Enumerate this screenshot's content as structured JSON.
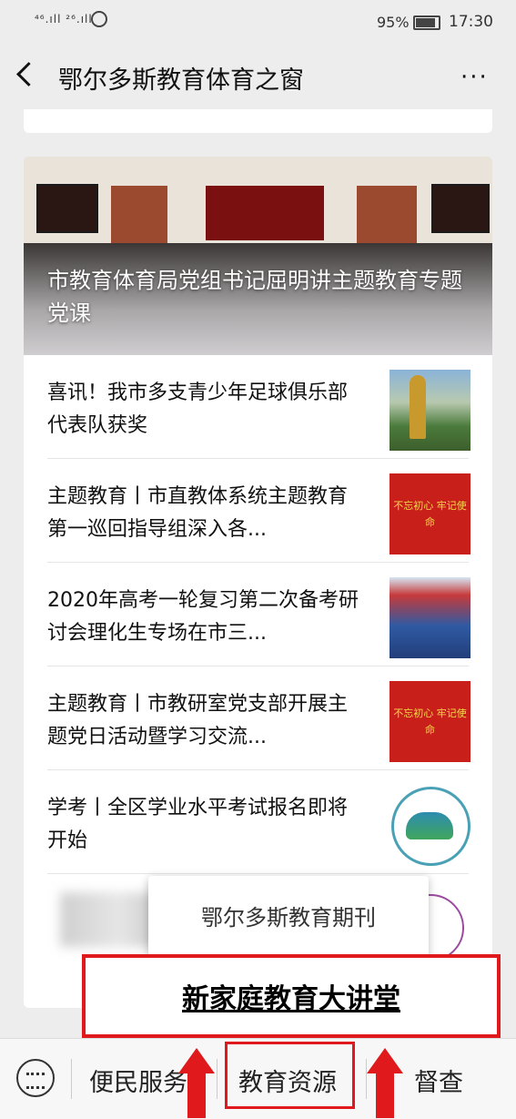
{
  "status": {
    "signal_text": "⁴⁶.ıll ²⁶.ıll",
    "battery": "95%",
    "time": "17:30"
  },
  "nav": {
    "title": "鄂尔多斯教育体育之窗",
    "more": "···"
  },
  "hero": {
    "caption": "市教育体育局党组书记屈明讲主题教育专题党课"
  },
  "articles": [
    {
      "title": "喜讯！我市多支青少年足球俱乐部代表队获奖"
    },
    {
      "title": "主题教育丨市直教体系统主题教育第一巡回指导组深入各...",
      "thumb_text": "不忘初心 牢记使命"
    },
    {
      "title": "2020年高考一轮复习第二次备考研讨会理化生专场在市三..."
    },
    {
      "title": "主题教育丨市教研室党支部开展主题党日活动暨学习交流...",
      "thumb_text": "不忘初心 牢记使命"
    },
    {
      "title": "学考丨全区学业水平考试报名即将开始"
    }
  ],
  "popup": {
    "item1": "鄂尔多斯教育期刊",
    "item2": "新家庭教育大讲堂"
  },
  "menu": {
    "item1": "便民服务",
    "item2": "教育资源",
    "item3": "督查"
  },
  "colors": {
    "annotation_red": "#e0191c",
    "thumb_red": "#c81f1a"
  }
}
